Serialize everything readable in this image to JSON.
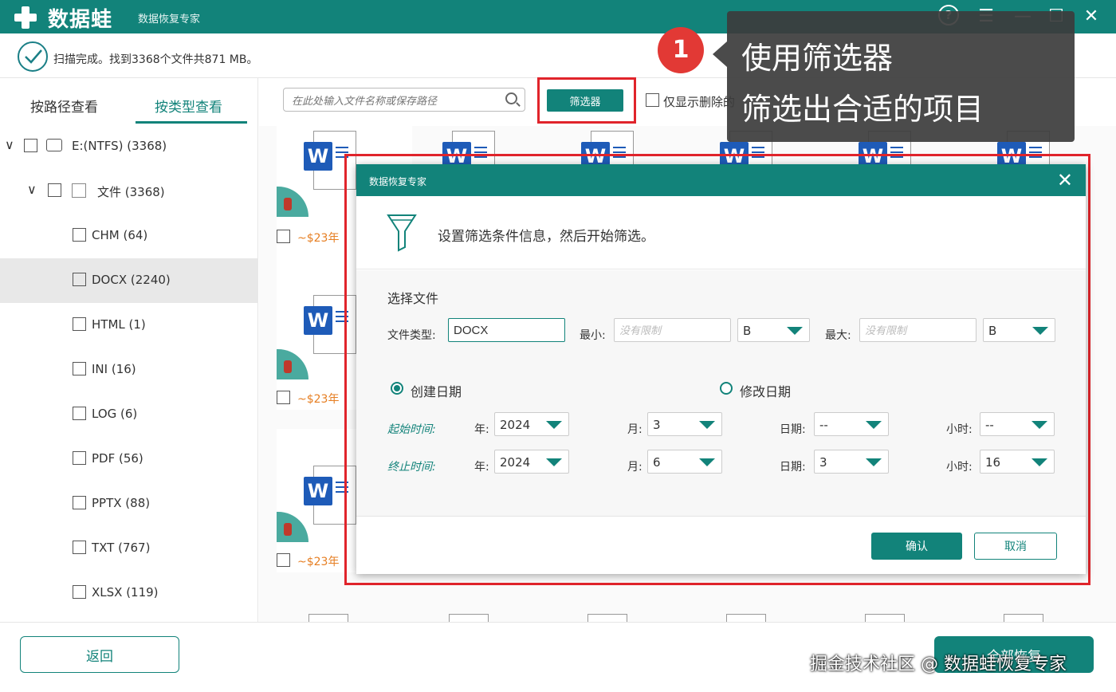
{
  "app": {
    "logo_text": "数据蛙",
    "subtitle": "数据恢复专家",
    "help_glyph": "?",
    "menu_glyph": "☰",
    "minimize_glyph": "—",
    "maximize_glyph": "☐",
    "close_glyph": "✕"
  },
  "status": {
    "text": "扫描完成。找到3368个文件共871 MB。"
  },
  "tabs": [
    {
      "label": "按路径查看",
      "active": false
    },
    {
      "label": "按类型查看",
      "active": true
    }
  ],
  "tree": {
    "drive": {
      "label": "E:(NTFS) (3368)"
    },
    "folder": {
      "label": "文件 (3368)"
    },
    "types": [
      {
        "label": "CHM (64)",
        "selected": false
      },
      {
        "label": "DOCX (2240)",
        "selected": true
      },
      {
        "label": "HTML (1)",
        "selected": false
      },
      {
        "label": "INI (16)",
        "selected": false
      },
      {
        "label": "LOG (6)",
        "selected": false
      },
      {
        "label": "PDF (56)",
        "selected": false
      },
      {
        "label": "PPTX (88)",
        "selected": false
      },
      {
        "label": "TXT (767)",
        "selected": false
      },
      {
        "label": "XLSX (119)",
        "selected": false
      }
    ]
  },
  "toolbar": {
    "search_placeholder": "在此处输入文件名称或保存路径",
    "filter_label": "筛选器",
    "only_deleted_label": "仅显示删除的"
  },
  "cards": {
    "word_badge": "W",
    "label": "~$23年"
  },
  "callout": {
    "step": "1",
    "line1": "使用筛选器",
    "line2": "筛选出合适的项目"
  },
  "dialog": {
    "title": "数据恢复专家",
    "close_glyph": "✕",
    "header_text": "设置筛选条件信息，然后开始筛选。",
    "section_label": "选择文件",
    "file_type_label": "文件类型:",
    "file_type_value": "DOCX",
    "min_label": "最小:",
    "min_placeholder": "没有限制",
    "min_unit": "B",
    "max_label": "最大:",
    "max_placeholder": "没有限制",
    "max_unit": "B",
    "date_options": [
      {
        "label": "创建日期",
        "checked": true
      },
      {
        "label": "修改日期",
        "checked": false
      }
    ],
    "start_label": "起始时间:",
    "end_label": "终止时间:",
    "year_label": "年:",
    "month_label": "月:",
    "day_label": "日期:",
    "hour_label": "小时:",
    "start": {
      "year": "2024",
      "month": "3",
      "day": "--",
      "hour": "--"
    },
    "end": {
      "year": "2024",
      "month": "6",
      "day": "3",
      "hour": "16"
    },
    "ok_label": "确认",
    "cancel_label": "取消"
  },
  "bottom": {
    "back_label": "返回",
    "recover_label": "全部恢复",
    "watermark": "掘金技术社区 @ 数据蛙恢复专家"
  },
  "colors": {
    "accent": "#12837a",
    "highlight": "#e0242b",
    "word_blue": "#1e5bb8"
  }
}
